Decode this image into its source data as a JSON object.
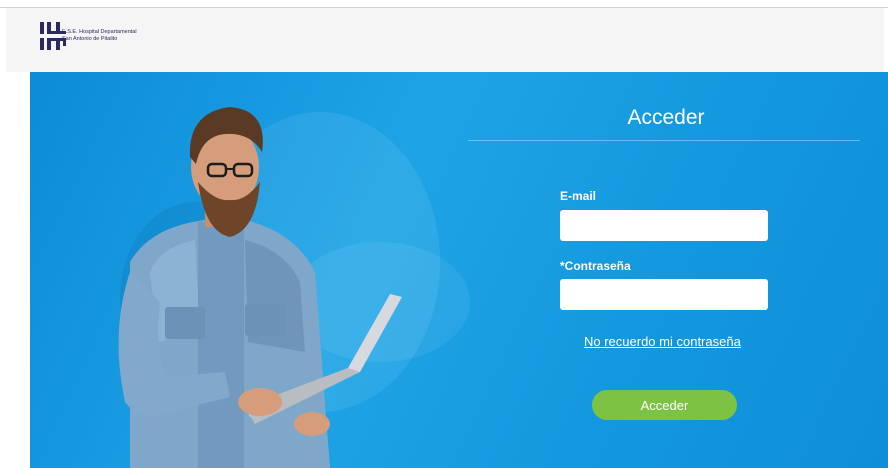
{
  "header": {
    "org_line1": "E.S.E. Hospital Departamental",
    "org_line2": "San Antonio de Pitalito"
  },
  "login": {
    "title": "Acceder",
    "email_label": "E-mail",
    "email_value": "",
    "password_label": "*Contraseña",
    "password_value": "",
    "forgot_link": "No recuerdo mi contraseña",
    "submit_label": "Acceder"
  },
  "colors": {
    "hero_blue": "#1ea4e6",
    "button_green": "#7dc242",
    "logo_navy": "#2b2a5e"
  },
  "icons": {
    "logo": "hospital-logo-icon"
  }
}
